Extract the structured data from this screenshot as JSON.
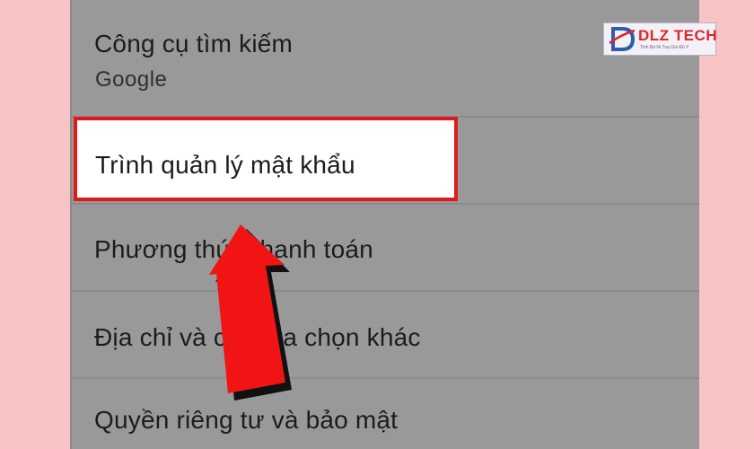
{
  "settings": {
    "search_engine": {
      "title": "Công cụ tìm kiếm",
      "value": "Google"
    },
    "password_manager": {
      "title": "Trình quản lý mật khẩu"
    },
    "payment_methods": {
      "title": "Phương thức thanh toán"
    },
    "addresses": {
      "title": "Địa chỉ và các lựa chọn khác"
    },
    "privacy": {
      "title": "Quyền riêng tư và bảo mật"
    }
  },
  "watermark": {
    "brand": "DLZ TECH",
    "tagline": "Tinh Bá Ni Tua Gói Đủ Y"
  },
  "annotation": {
    "highlight_color": "#e01a1a",
    "arrow_color": "#f01414"
  }
}
